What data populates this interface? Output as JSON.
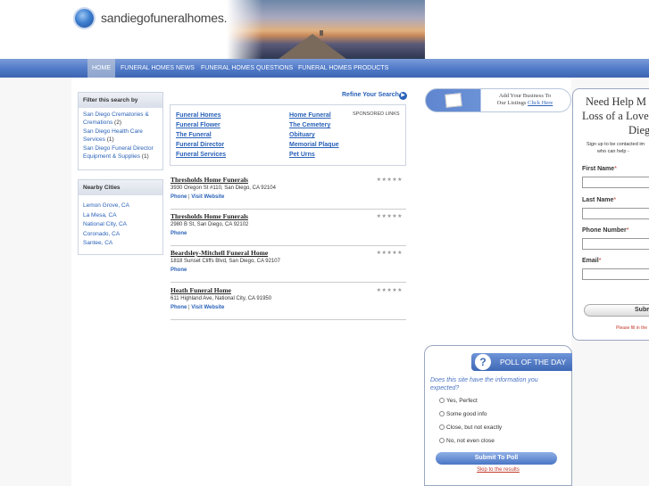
{
  "header": {
    "site_name": "sandiegofuneralhomes.com"
  },
  "nav": {
    "items": [
      {
        "label": "HOME",
        "active": true
      },
      {
        "label": "FUNERAL HOMES NEWS"
      },
      {
        "label": "FUNERAL HOMES QUESTIONS"
      },
      {
        "label": "FUNERAL HOMES PRODUCTS"
      }
    ]
  },
  "sidebar": {
    "filter_title": "Filter this search by",
    "filters": [
      {
        "label": "San Diego Crematories & Cremations",
        "count": "(2)"
      },
      {
        "label": "San Diego Health Care Services",
        "count": "(1)"
      },
      {
        "label": "San Diego Funeral Director Equipment & Supplies",
        "count": "(1)"
      }
    ],
    "cities_title": "Nearby Cities",
    "cities": [
      "Lemon Grove, CA",
      "La Mesa, CA",
      "National City, CA",
      "Coronado, CA",
      "Santee, CA"
    ]
  },
  "refine": {
    "label": "Refine Your Search",
    "arrow": "▶"
  },
  "sponsored": {
    "label": "SPONSORED LINKS",
    "left": [
      "Funeral Homes",
      "Funeral Flower",
      "The Funeral",
      "Funeral Director",
      "Funeral Services"
    ],
    "right": [
      "Home Funeral",
      "The Cemetery",
      "Obituary",
      "Memorial Plaque",
      "Pet Urns"
    ]
  },
  "listings": [
    {
      "name": "Thresholds Home Funerals",
      "address": "3930 Oregon St #110, San Diego, CA 92104",
      "phone": "Phone",
      "website": "Visit Website",
      "stars": "★★★★★"
    },
    {
      "name": "Thresholds Home Funerals",
      "address": "2980 B St, San Diego, CA 92102",
      "phone": "Phone",
      "website": "",
      "stars": "★★★★★"
    },
    {
      "name": "Beardsley-Mitchell Funeral Home",
      "address": "1818 Sunset Cliffs Blvd, San Diego, CA 92107",
      "phone": "Phone",
      "website": "",
      "stars": "★★★★★"
    },
    {
      "name": "Heath Funeral Home",
      "address": "611 Highland Ave, National City, CA 91950",
      "phone": "Phone",
      "website": "Visit Website",
      "stars": "★★★★★"
    }
  ],
  "links_separator": " | ",
  "add_business": {
    "line1": "Add Your Business To",
    "line2": "Our Listings",
    "link": "Click Here"
  },
  "form": {
    "title_lines": [
      "Need Help M",
      "Loss of a Loved",
      "Dieg"
    ],
    "sub_lines": [
      "Sign up to be contacted im",
      "who can help -"
    ],
    "fields": [
      "First Name",
      "Last Name",
      "Phone Number",
      "Email"
    ],
    "required_mark": "*",
    "submit": "Subm",
    "note": "Please fill in the"
  },
  "poll": {
    "title": "POLL OF THE DAY",
    "icon": "?",
    "question": "Does this site have the information you expected?",
    "options": [
      "Yes, Perfect",
      "Some good info",
      "Close, but not exactly",
      "No, not even close"
    ],
    "submit": "Submit To Poll",
    "skip": "Skip to the results"
  }
}
